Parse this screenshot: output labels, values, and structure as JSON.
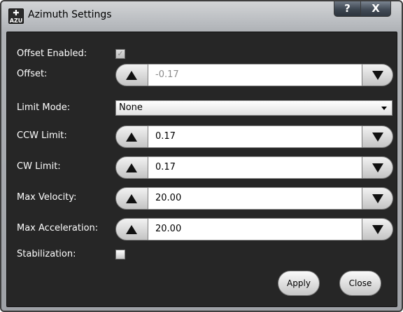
{
  "window": {
    "title": "Azimuth Settings",
    "icon_text": "AZU",
    "help_label": "?",
    "close_label": "X"
  },
  "form": {
    "offset_enabled": {
      "label": "Offset Enabled:",
      "checked": true,
      "enabled": false
    },
    "offset": {
      "label": "Offset:",
      "value": "-0.17",
      "enabled": false
    },
    "limit_mode": {
      "label": "Limit Mode:",
      "value": "None"
    },
    "ccw_limit": {
      "label": "CCW Limit:",
      "value": "0.17"
    },
    "cw_limit": {
      "label": "CW Limit:",
      "value": "0.17"
    },
    "max_velocity": {
      "label": "Max Velocity:",
      "value": "20.00"
    },
    "max_acceleration": {
      "label": "Max Acceleration:",
      "value": "20.00"
    },
    "stabilization": {
      "label": "Stabilization:",
      "checked": false
    }
  },
  "buttons": {
    "apply": "Apply",
    "close": "Close"
  }
}
